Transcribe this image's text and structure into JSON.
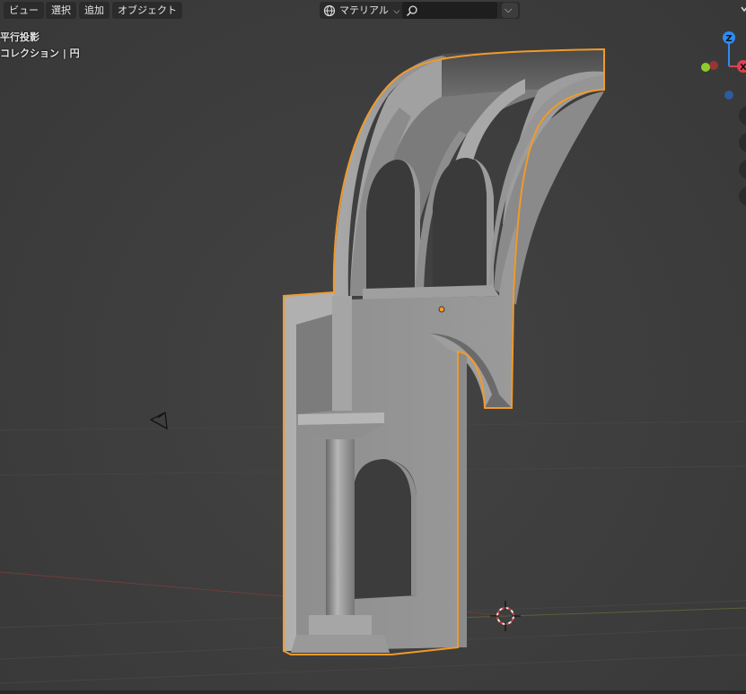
{
  "header": {
    "menus": [
      {
        "label": "ビュー"
      },
      {
        "label": "選択"
      },
      {
        "label": "追加"
      },
      {
        "label": "オブジェクト"
      }
    ],
    "shading": {
      "label": "マテリアル",
      "icon": "globe-icon",
      "search_icon": "search-icon",
      "dropdown_icon": "chevron-down-icon"
    }
  },
  "overlay": {
    "view_mode": "平行投影",
    "collection_info": "コレクション | 円"
  },
  "gizmo": {
    "z_label": "Z",
    "x_label": "X"
  },
  "colors": {
    "background": "#3d3d3d",
    "header": "#2b2b2b",
    "selection_outline": "#f19a2a",
    "axis_x": "#e04050",
    "axis_y": "#8ccc2a",
    "axis_z": "#2e8bf0"
  }
}
